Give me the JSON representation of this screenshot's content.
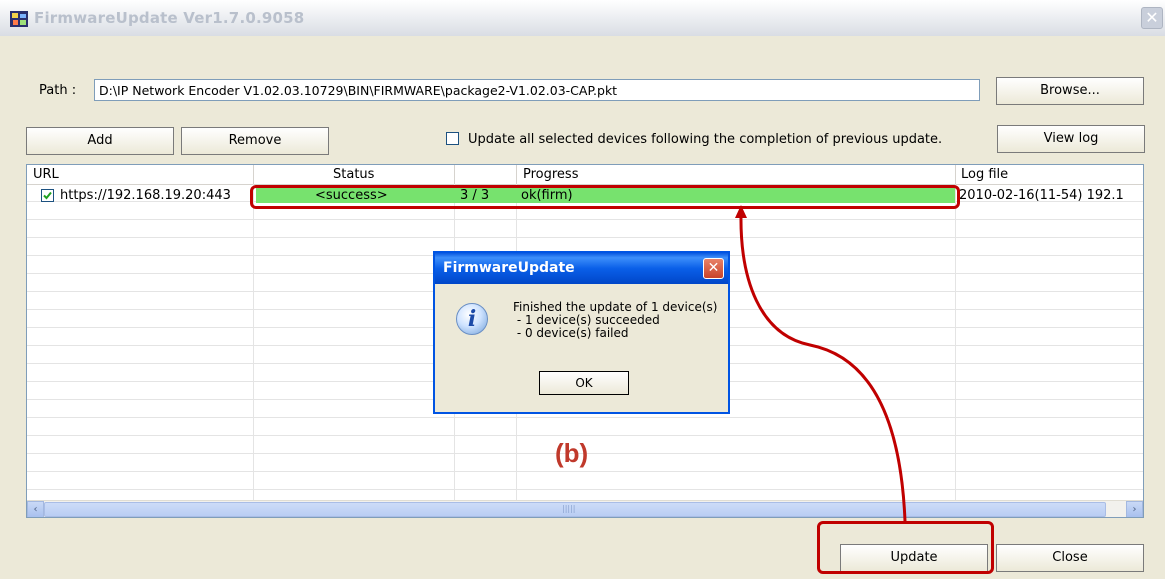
{
  "window": {
    "title": "FirmwareUpdate Ver1.7.0.9058",
    "close_glyph": "✕"
  },
  "path": {
    "label": "Path :",
    "value": "D:\\IP Network Encoder V1.02.03.10729\\BIN\\FIRMWARE\\package2-V1.02.03-CAP.pkt"
  },
  "buttons": {
    "browse": "Browse...",
    "add": "Add",
    "remove": "Remove",
    "view_log": "View log",
    "update": "Update",
    "close": "Close"
  },
  "options": {
    "sequential_update_label": "Update all selected devices following the completion of previous update.",
    "sequential_update_checked": false
  },
  "table": {
    "columns": [
      "URL",
      "Status",
      "",
      "Progress",
      "Log file"
    ],
    "rows": [
      {
        "checked": true,
        "url": "https://192.168.19.20:443",
        "status": "<success>",
        "count": "3 / 3",
        "progress": "ok(firm)",
        "log_file": "2010-02-16(11-54) 192.1"
      }
    ],
    "highlight_color": "#77e26e"
  },
  "dialog": {
    "title": "FirmwareUpdate",
    "close_glyph": "✕",
    "icon": "info-icon",
    "lines": [
      "Finished the update of 1 device(s)",
      " - 1 device(s) succeeded",
      " - 0 device(s) failed"
    ],
    "ok_label": "OK"
  },
  "annotation": {
    "label": "(b)",
    "color": "#c00000"
  },
  "scrollbar": {
    "left_arrow": "‹",
    "right_arrow": "›",
    "grip": "|||||"
  }
}
